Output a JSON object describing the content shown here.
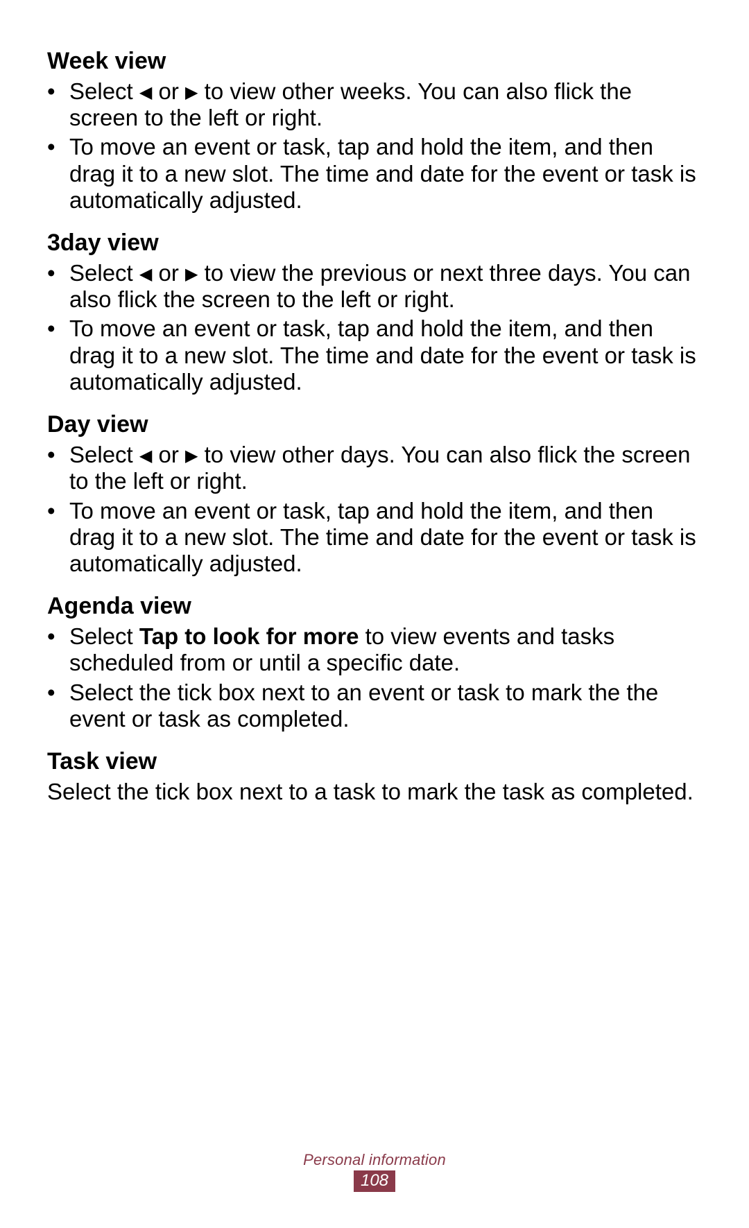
{
  "glyphs": {
    "left_arrow": "◀",
    "right_arrow": "▶"
  },
  "sections": [
    {
      "heading": "Week view",
      "items": [
        {
          "segments": [
            {
              "text": "Select "
            },
            {
              "glyph": "left_arrow"
            },
            {
              "text": " or "
            },
            {
              "glyph": "right_arrow"
            },
            {
              "text": " to view other weeks. You can also flick the screen to the left or right."
            }
          ]
        },
        {
          "segments": [
            {
              "text": "To move an event or task, tap and hold the item, and then drag it to a new slot. The time and date for the event or task is automatically adjusted."
            }
          ]
        }
      ]
    },
    {
      "heading": "3day view",
      "items": [
        {
          "segments": [
            {
              "text": "Select "
            },
            {
              "glyph": "left_arrow"
            },
            {
              "text": " or "
            },
            {
              "glyph": "right_arrow"
            },
            {
              "text": " to view the previous or next three days. You can also flick the screen to the left or right."
            }
          ]
        },
        {
          "segments": [
            {
              "text": "To move an event or task, tap and hold the item, and then drag it to a new slot. The time and date for the event or task is automatically adjusted."
            }
          ]
        }
      ]
    },
    {
      "heading": "Day view",
      "items": [
        {
          "segments": [
            {
              "text": "Select "
            },
            {
              "glyph": "left_arrow"
            },
            {
              "text": " or "
            },
            {
              "glyph": "right_arrow"
            },
            {
              "text": " to view other days. You can also flick the screen to the left or right."
            }
          ]
        },
        {
          "segments": [
            {
              "text": "To move an event or task, tap and hold the item, and then drag it to a new slot. The time and date for the event or task is automatically adjusted."
            }
          ]
        }
      ]
    },
    {
      "heading": "Agenda view",
      "items": [
        {
          "segments": [
            {
              "text": "Select "
            },
            {
              "text": "Tap to look for more",
              "bold": true
            },
            {
              "text": " to view events and tasks scheduled from or until a specific date."
            }
          ]
        },
        {
          "segments": [
            {
              "text": "Select the tick box next to an event or task to mark the the event or task as completed."
            }
          ]
        }
      ]
    },
    {
      "heading": "Task view",
      "paragraph": "Select the tick box next to a task to mark the task as completed."
    }
  ],
  "footer": {
    "section_title": "Personal information",
    "page_number": "108"
  }
}
